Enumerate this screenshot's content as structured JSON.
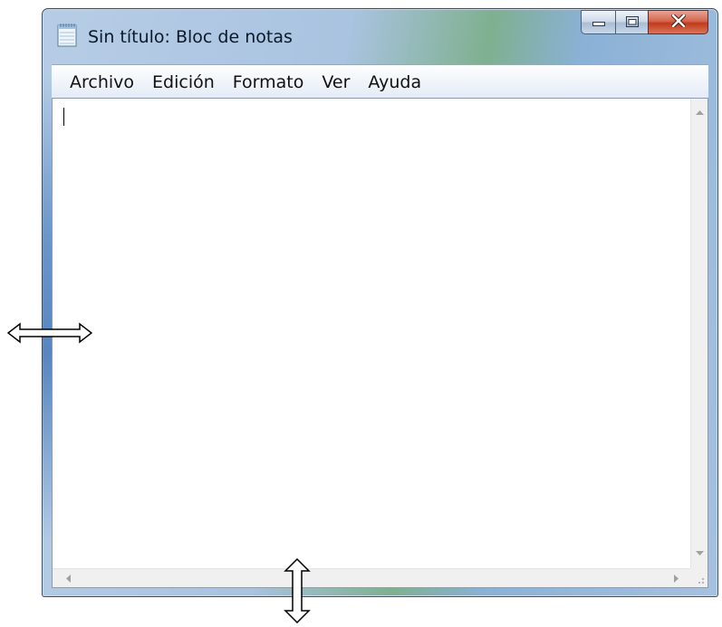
{
  "window": {
    "title": "Sin título: Bloc de notas",
    "icon": "notepad-icon",
    "caption_buttons": [
      "minimize-icon",
      "maximize-icon",
      "close-icon"
    ],
    "close_color": "#c9422a"
  },
  "menubar": {
    "items": [
      {
        "label": "Archivo"
      },
      {
        "label": "Edición"
      },
      {
        "label": "Formato"
      },
      {
        "label": "Ver"
      },
      {
        "label": "Ayuda"
      }
    ]
  },
  "editor": {
    "content": ""
  },
  "cursors": [
    "horizontal-resize-arrow-icon",
    "vertical-resize-arrow-icon"
  ]
}
